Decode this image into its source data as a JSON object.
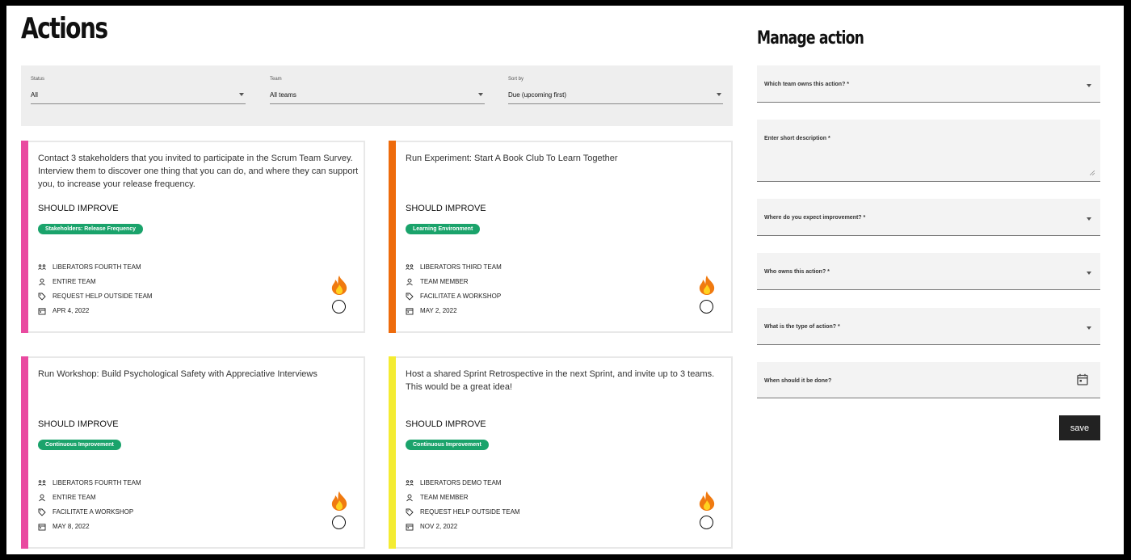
{
  "page": {
    "title": "Actions"
  },
  "filters": {
    "status": {
      "label": "Status",
      "value": "All"
    },
    "team": {
      "label": "Team",
      "value": "All teams"
    },
    "sort": {
      "label": "Sort by",
      "value": "Due (upcoming first)"
    }
  },
  "cards": [
    {
      "description": "Contact 3 stakeholders that you invited to participate in the Scrum Team Survey. Interview them to discover one thing that you can do, and where they can support you, to increase your release frequency.",
      "category": "SHOULD IMPROVE",
      "tag": "Stakeholders: Release Frequency",
      "team": "LIBERATORS FOURTH TEAM",
      "owner": "ENTIRE TEAM",
      "type": "REQUEST HELP OUTSIDE TEAM",
      "due": "APR 4, 2022",
      "stripe_color": "#e94aa0"
    },
    {
      "description": "Run Experiment: Start A Book Club To Learn Together",
      "category": "SHOULD IMPROVE",
      "tag": "Learning Environment",
      "team": "LIBERATORS THIRD TEAM",
      "owner": "TEAM MEMBER",
      "type": "FACILITATE A WORKSHOP",
      "due": "MAY 2, 2022",
      "stripe_color": "#ee6b0c"
    },
    {
      "description": "Run Workshop: Build Psychological Safety with Appreciative Interviews",
      "category": "SHOULD IMPROVE",
      "tag": "Continuous Improvement",
      "team": "LIBERATORS FOURTH TEAM",
      "owner": "ENTIRE TEAM",
      "type": "FACILITATE A WORKSHOP",
      "due": "MAY 8, 2022",
      "stripe_color": "#e94aa0"
    },
    {
      "description": "Host a shared Sprint Retrospective in the next Sprint, and invite up to 3 teams. This would be a great idea!",
      "category": "SHOULD IMPROVE",
      "tag": "Continuous Improvement",
      "team": "LIBERATORS DEMO TEAM",
      "owner": "TEAM MEMBER",
      "type": "REQUEST HELP OUTSIDE TEAM",
      "due": "NOV 2, 2022",
      "stripe_color": "#f4ec32"
    }
  ],
  "manage": {
    "title": "Manage action",
    "fields": {
      "team": "Which team owns this action? *",
      "description": "Enter short description *",
      "improvement": "Where do you expect improvement? *",
      "owner": "Who owns this action? *",
      "type": "What is the type of action? *",
      "due": "When should it be done?"
    },
    "save_label": "save"
  },
  "colors": {
    "tag_green": "#1aa36b",
    "pink": "#e94aa0",
    "orange": "#ee6b0c",
    "yellow": "#f4ec32",
    "button_dark": "#222222"
  },
  "icons": [
    "caret-down-icon",
    "team-icon",
    "person-icon",
    "tag-icon",
    "calendar-icon",
    "flame-icon",
    "circle-check-icon"
  ]
}
